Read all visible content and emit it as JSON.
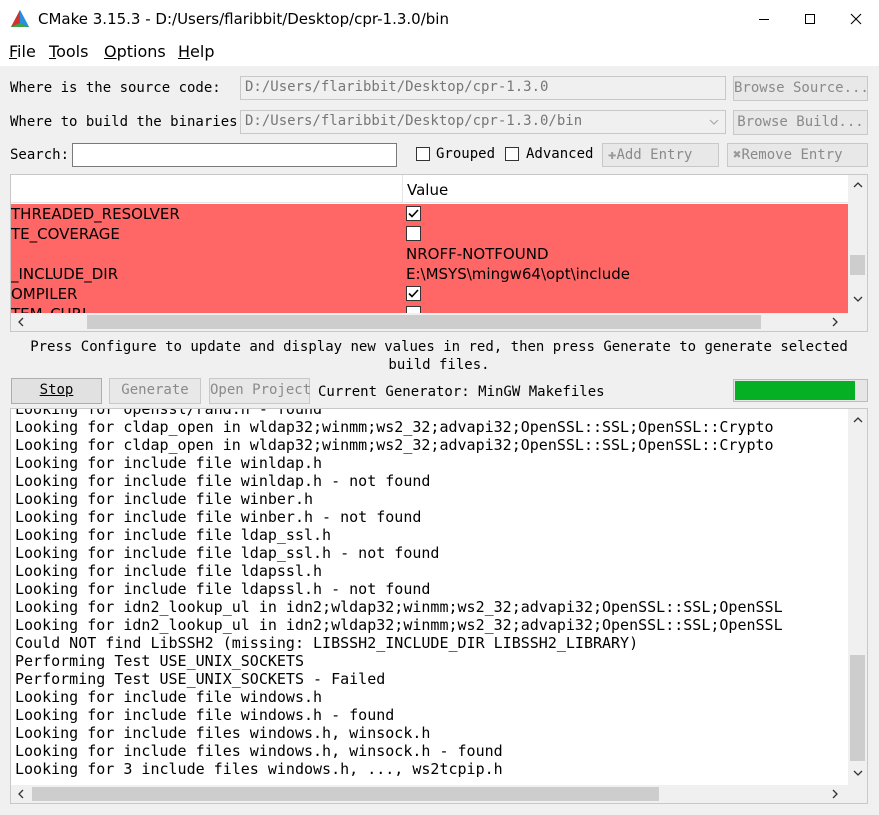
{
  "window": {
    "title": "CMake 3.15.3 - D:/Users/flaribbit/Desktop/cpr-1.3.0/bin"
  },
  "menu": [
    {
      "mnemonic": "F",
      "rest": "ile"
    },
    {
      "mnemonic": "T",
      "rest": "ools"
    },
    {
      "mnemonic": "O",
      "rest": "ptions"
    },
    {
      "mnemonic": "H",
      "rest": "elp"
    }
  ],
  "source": {
    "label": "Where is the source code:",
    "value": "D:/Users/flaribbit/Desktop/cpr-1.3.0",
    "browse_label": "Browse Source..."
  },
  "build": {
    "label": "Where to build the binaries:",
    "value": "D:/Users/flaribbit/Desktop/cpr-1.3.0/bin",
    "browse_label": "Browse Build..."
  },
  "search": {
    "label": "Search:",
    "value": ""
  },
  "options": {
    "grouped_label": "Grouped",
    "advanced_label": "Advanced",
    "grouped": false,
    "advanced": false
  },
  "entry_buttons": {
    "add": "Add Entry",
    "remove": "Remove Entry"
  },
  "cache_table": {
    "value_header": "Value",
    "rows": [
      {
        "name": "THREADED_RESOLVER",
        "type": "bool",
        "checked": true,
        "value": ""
      },
      {
        "name": "TE_COVERAGE",
        "type": "bool",
        "checked": false,
        "value": ""
      },
      {
        "name": "",
        "type": "text",
        "checked": false,
        "value": "NROFF-NOTFOUND"
      },
      {
        "name": "_INCLUDE_DIR",
        "type": "text",
        "checked": false,
        "value": "E:\\MSYS\\mingw64\\opt\\include"
      },
      {
        "name": "OMPILER",
        "type": "bool",
        "checked": true,
        "value": ""
      },
      {
        "name": "TEM_CURL",
        "type": "bool",
        "checked": false,
        "value": ""
      }
    ]
  },
  "info": {
    "message": "Press Configure to update and display new values in red, then press Generate to generate selected build files."
  },
  "actions": {
    "stop": "Stop",
    "generate": "Generate",
    "open_project": "Open Project",
    "generator_label": "Current Generator: MinGW Makefiles"
  },
  "progress": {
    "fraction": 0.9
  },
  "log": {
    "lines": [
      "Looking for openssl/rand.h - found",
      "Looking for cldap_open in wldap32;winmm;ws2_32;advapi32;OpenSSL::SSL;OpenSSL::Crypto",
      "Looking for cldap_open in wldap32;winmm;ws2_32;advapi32;OpenSSL::SSL;OpenSSL::Crypto",
      "Looking for include file winldap.h",
      "Looking for include file winldap.h - not found",
      "Looking for include file winber.h",
      "Looking for include file winber.h - not found",
      "Looking for include file ldap_ssl.h",
      "Looking for include file ldap_ssl.h - not found",
      "Looking for include file ldapssl.h",
      "Looking for include file ldapssl.h - not found",
      "Looking for idn2_lookup_ul in idn2;wldap32;winmm;ws2_32;advapi32;OpenSSL::SSL;OpenSSL",
      "Looking for idn2_lookup_ul in idn2;wldap32;winmm;ws2_32;advapi32;OpenSSL::SSL;OpenSSL",
      "Could NOT find LibSSH2 (missing: LIBSSH2_INCLUDE_DIR LIBSSH2_LIBRARY)",
      "Performing Test USE_UNIX_SOCKETS",
      "Performing Test USE_UNIX_SOCKETS - Failed",
      "Looking for include file windows.h",
      "Looking for include file windows.h - found",
      "Looking for include files windows.h, winsock.h",
      "Looking for include files windows.h, winsock.h - found",
      "Looking for 3 include files windows.h, ..., ws2tcpip.h"
    ]
  }
}
